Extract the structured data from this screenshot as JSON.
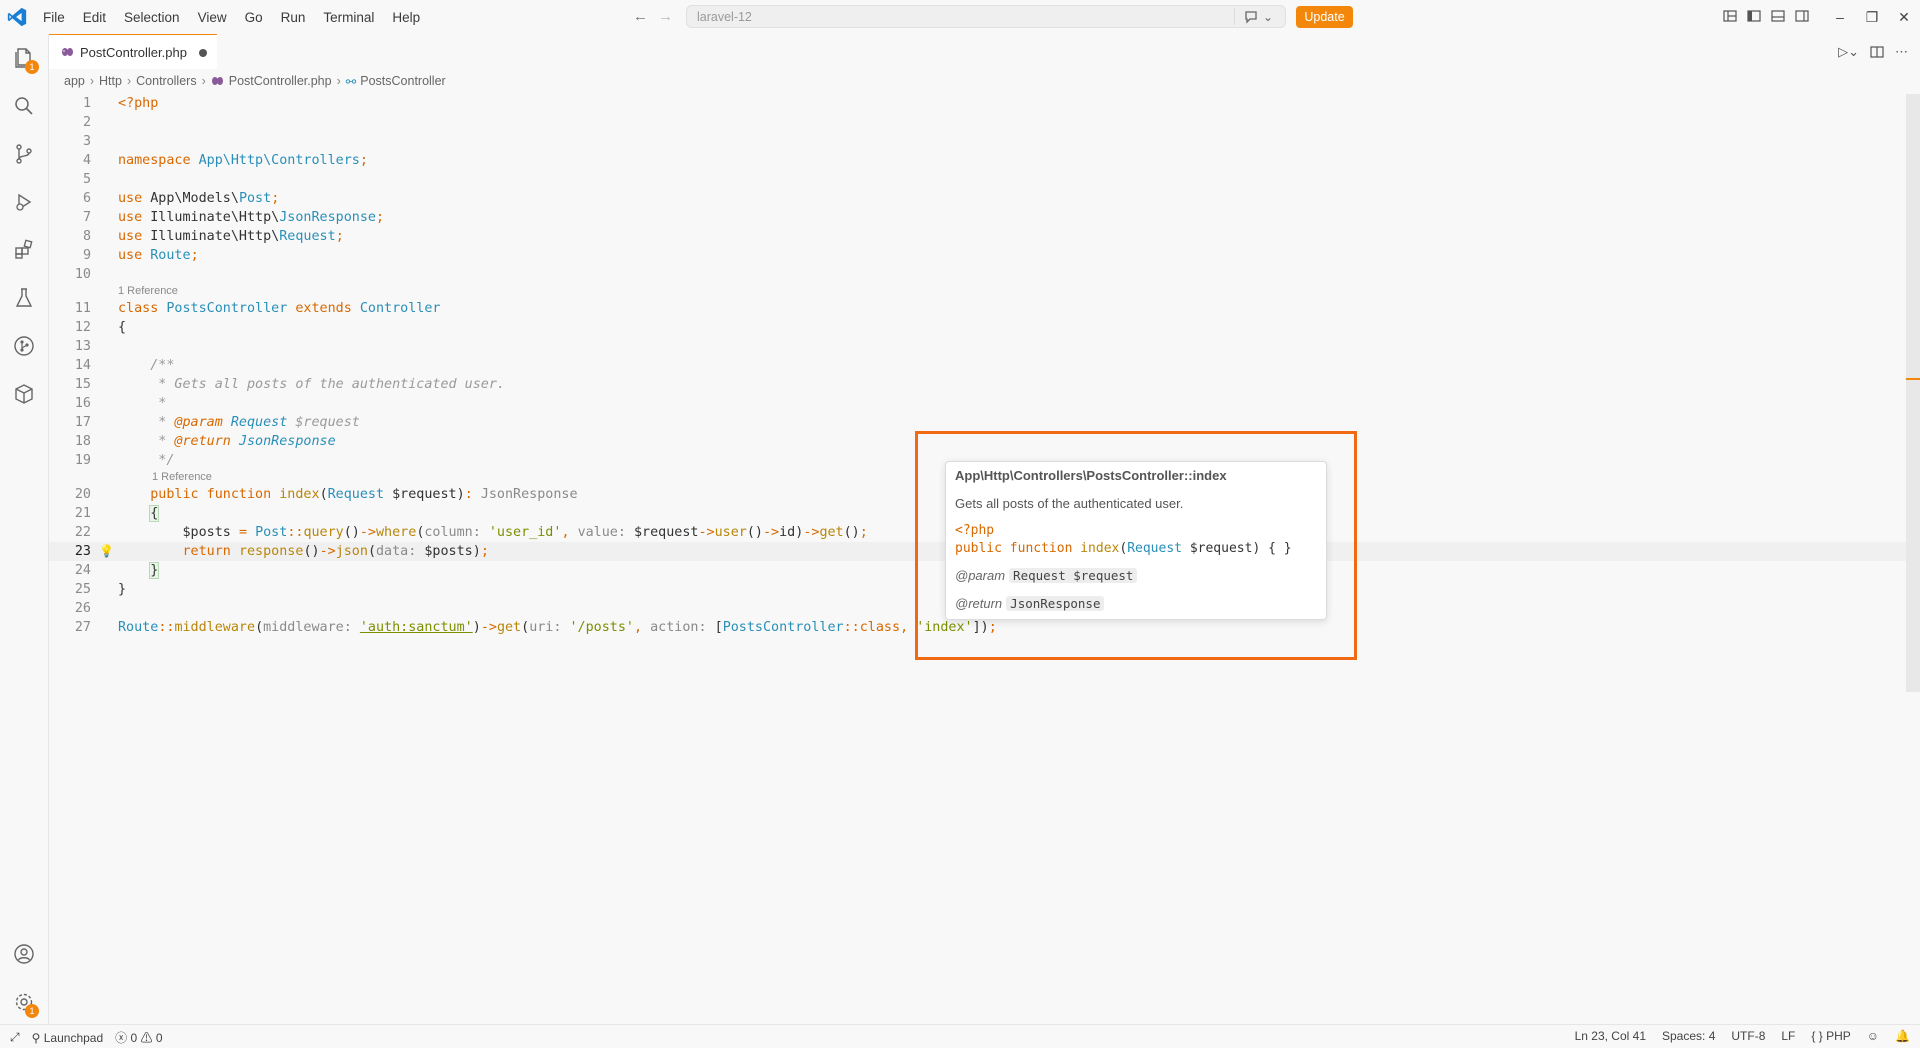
{
  "window": {
    "menu": [
      "File",
      "Edit",
      "Selection",
      "View",
      "Go",
      "Run",
      "Terminal",
      "Help"
    ],
    "search_text": "laravel-12",
    "update_label": "Update"
  },
  "activity": {
    "explorer_badge": "1",
    "settings_badge": "1"
  },
  "tab": {
    "name": "PostController.php"
  },
  "breadcrumb": {
    "items": [
      "app",
      "Http",
      "Controllers",
      "PostController.php",
      "PostsController"
    ]
  },
  "editor": {
    "lens1": "1 Reference",
    "lens2": "1 Reference",
    "line_numbers": [
      "1",
      "2",
      "3",
      "4",
      "5",
      "6",
      "7",
      "8",
      "9",
      "10",
      "11",
      "12",
      "13",
      "14",
      "15",
      "16",
      "17",
      "18",
      "19",
      "20",
      "21",
      "22",
      "23",
      "24",
      "25",
      "26",
      "27"
    ],
    "current_line": "23"
  },
  "hover": {
    "signature": "App\\Http\\Controllers\\PostsController::index",
    "description": "Gets all posts of the authenticated user.",
    "code_open": "<?php",
    "param_tag": "@param",
    "param_val": "Request $request",
    "return_tag": "@return",
    "return_val": "JsonResponse"
  },
  "status": {
    "launchpad": "Launchpad",
    "errors": "0",
    "warnings": "0",
    "position": "Ln 23, Col 41",
    "spaces": "Spaces: 4",
    "encoding": "UTF-8",
    "eol": "LF",
    "language": "PHP"
  }
}
